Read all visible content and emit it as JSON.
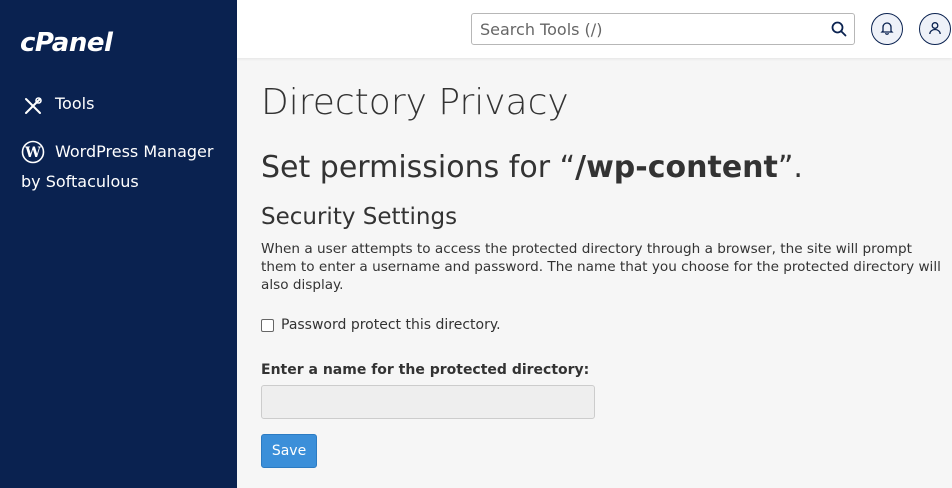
{
  "sidebar": {
    "logo": "cPanel",
    "items": [
      {
        "label": "Tools",
        "icon": "tools-icon"
      },
      {
        "label": "WordPress Manager",
        "label_line2": "by Softaculous",
        "icon": "wordpress-icon"
      }
    ],
    "background": "#0a2250"
  },
  "topbar": {
    "search_placeholder": "Search Tools (/)",
    "search_value": ""
  },
  "main": {
    "title": "Directory Privacy",
    "permissions_prefix": "Set permissions for “",
    "directory": "/wp-content",
    "permissions_suffix": "”.",
    "section_title": "Security Settings",
    "description": "When a user attempts to access the protected directory through a browser, the site will prompt them to enter a username and password. The name that you choose for the protected directory will also display.",
    "checkbox_label": "Password protect this directory.",
    "checkbox_checked": false,
    "name_field_label": "Enter a name for the protected directory:",
    "name_field_value": "",
    "save_label": "Save"
  },
  "colors": {
    "accent": "#3b8fd9",
    "sidebar": "#0a2250"
  }
}
